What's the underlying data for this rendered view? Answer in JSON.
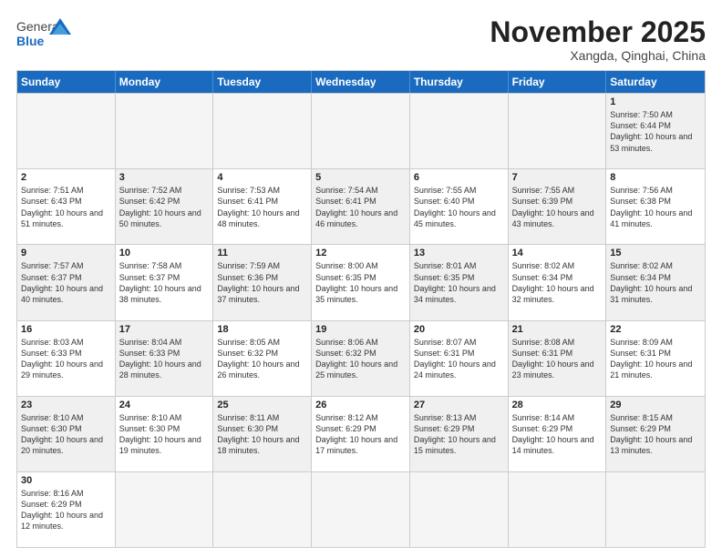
{
  "header": {
    "logo_general": "General",
    "logo_blue": "Blue",
    "month_title": "November 2025",
    "location": "Xangda, Qinghai, China"
  },
  "weekdays": [
    "Sunday",
    "Monday",
    "Tuesday",
    "Wednesday",
    "Thursday",
    "Friday",
    "Saturday"
  ],
  "rows": [
    [
      {
        "day": "",
        "empty": true,
        "info": ""
      },
      {
        "day": "",
        "empty": true,
        "info": ""
      },
      {
        "day": "",
        "empty": true,
        "info": ""
      },
      {
        "day": "",
        "empty": true,
        "info": ""
      },
      {
        "day": "",
        "empty": true,
        "info": ""
      },
      {
        "day": "",
        "empty": true,
        "info": ""
      },
      {
        "day": "1",
        "shaded": true,
        "info": "Sunrise: 7:50 AM\nSunset: 6:44 PM\nDaylight: 10 hours\nand 53 minutes."
      }
    ],
    [
      {
        "day": "2",
        "info": "Sunrise: 7:51 AM\nSunset: 6:43 PM\nDaylight: 10 hours\nand 51 minutes."
      },
      {
        "day": "3",
        "shaded": true,
        "info": "Sunrise: 7:52 AM\nSunset: 6:42 PM\nDaylight: 10 hours\nand 50 minutes."
      },
      {
        "day": "4",
        "info": "Sunrise: 7:53 AM\nSunset: 6:41 PM\nDaylight: 10 hours\nand 48 minutes."
      },
      {
        "day": "5",
        "shaded": true,
        "info": "Sunrise: 7:54 AM\nSunset: 6:41 PM\nDaylight: 10 hours\nand 46 minutes."
      },
      {
        "day": "6",
        "info": "Sunrise: 7:55 AM\nSunset: 6:40 PM\nDaylight: 10 hours\nand 45 minutes."
      },
      {
        "day": "7",
        "shaded": true,
        "info": "Sunrise: 7:55 AM\nSunset: 6:39 PM\nDaylight: 10 hours\nand 43 minutes."
      },
      {
        "day": "8",
        "info": "Sunrise: 7:56 AM\nSunset: 6:38 PM\nDaylight: 10 hours\nand 41 minutes."
      }
    ],
    [
      {
        "day": "9",
        "shaded": true,
        "info": "Sunrise: 7:57 AM\nSunset: 6:37 PM\nDaylight: 10 hours\nand 40 minutes."
      },
      {
        "day": "10",
        "info": "Sunrise: 7:58 AM\nSunset: 6:37 PM\nDaylight: 10 hours\nand 38 minutes."
      },
      {
        "day": "11",
        "shaded": true,
        "info": "Sunrise: 7:59 AM\nSunset: 6:36 PM\nDaylight: 10 hours\nand 37 minutes."
      },
      {
        "day": "12",
        "info": "Sunrise: 8:00 AM\nSunset: 6:35 PM\nDaylight: 10 hours\nand 35 minutes."
      },
      {
        "day": "13",
        "shaded": true,
        "info": "Sunrise: 8:01 AM\nSunset: 6:35 PM\nDaylight: 10 hours\nand 34 minutes."
      },
      {
        "day": "14",
        "info": "Sunrise: 8:02 AM\nSunset: 6:34 PM\nDaylight: 10 hours\nand 32 minutes."
      },
      {
        "day": "15",
        "shaded": true,
        "info": "Sunrise: 8:02 AM\nSunset: 6:34 PM\nDaylight: 10 hours\nand 31 minutes."
      }
    ],
    [
      {
        "day": "16",
        "info": "Sunrise: 8:03 AM\nSunset: 6:33 PM\nDaylight: 10 hours\nand 29 minutes."
      },
      {
        "day": "17",
        "shaded": true,
        "info": "Sunrise: 8:04 AM\nSunset: 6:33 PM\nDaylight: 10 hours\nand 28 minutes."
      },
      {
        "day": "18",
        "info": "Sunrise: 8:05 AM\nSunset: 6:32 PM\nDaylight: 10 hours\nand 26 minutes."
      },
      {
        "day": "19",
        "shaded": true,
        "info": "Sunrise: 8:06 AM\nSunset: 6:32 PM\nDaylight: 10 hours\nand 25 minutes."
      },
      {
        "day": "20",
        "info": "Sunrise: 8:07 AM\nSunset: 6:31 PM\nDaylight: 10 hours\nand 24 minutes."
      },
      {
        "day": "21",
        "shaded": true,
        "info": "Sunrise: 8:08 AM\nSunset: 6:31 PM\nDaylight: 10 hours\nand 23 minutes."
      },
      {
        "day": "22",
        "info": "Sunrise: 8:09 AM\nSunset: 6:31 PM\nDaylight: 10 hours\nand 21 minutes."
      }
    ],
    [
      {
        "day": "23",
        "shaded": true,
        "info": "Sunrise: 8:10 AM\nSunset: 6:30 PM\nDaylight: 10 hours\nand 20 minutes."
      },
      {
        "day": "24",
        "info": "Sunrise: 8:10 AM\nSunset: 6:30 PM\nDaylight: 10 hours\nand 19 minutes."
      },
      {
        "day": "25",
        "shaded": true,
        "info": "Sunrise: 8:11 AM\nSunset: 6:30 PM\nDaylight: 10 hours\nand 18 minutes."
      },
      {
        "day": "26",
        "info": "Sunrise: 8:12 AM\nSunset: 6:29 PM\nDaylight: 10 hours\nand 17 minutes."
      },
      {
        "day": "27",
        "shaded": true,
        "info": "Sunrise: 8:13 AM\nSunset: 6:29 PM\nDaylight: 10 hours\nand 15 minutes."
      },
      {
        "day": "28",
        "info": "Sunrise: 8:14 AM\nSunset: 6:29 PM\nDaylight: 10 hours\nand 14 minutes."
      },
      {
        "day": "29",
        "shaded": true,
        "info": "Sunrise: 8:15 AM\nSunset: 6:29 PM\nDaylight: 10 hours\nand 13 minutes."
      }
    ],
    [
      {
        "day": "30",
        "info": "Sunrise: 8:16 AM\nSunset: 6:29 PM\nDaylight: 10 hours\nand 12 minutes."
      },
      {
        "day": "",
        "empty": true,
        "info": ""
      },
      {
        "day": "",
        "empty": true,
        "info": ""
      },
      {
        "day": "",
        "empty": true,
        "info": ""
      },
      {
        "day": "",
        "empty": true,
        "info": ""
      },
      {
        "day": "",
        "empty": true,
        "info": ""
      },
      {
        "day": "",
        "empty": true,
        "info": ""
      }
    ]
  ]
}
